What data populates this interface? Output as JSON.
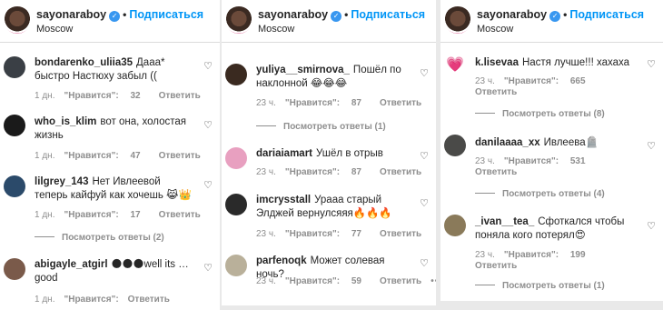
{
  "header": {
    "username": "sayonaraboy",
    "verified_mark": "✓",
    "separator": "•",
    "follow_label": "Подписаться",
    "location": "Moscow"
  },
  "common": {
    "likes_prefix": "\"Нравится\":",
    "reply_label": "Ответить",
    "heart": "♡"
  },
  "panels": [
    {
      "comments": [
        {
          "user": "bondarenko_uliia35",
          "text": "Дааа* быстро Настюху забыл ((",
          "time": "1 дн.",
          "likes": "32",
          "avatar_color": "#3a3f45"
        },
        {
          "user": "who_is_klim",
          "text": "вот она, холостая жизнь",
          "time": "1 дн.",
          "likes": "47",
          "avatar_color": "#1a1a1a"
        },
        {
          "user": "lilgrey_143",
          "text": "Нет Ивлеевой теперь кайфуй как хочешь 😹👑",
          "time": "1 дн.",
          "likes": "17",
          "avatar_color": "#2b4a6a",
          "replies": "Посмотреть ответы (2)"
        },
        {
          "user": "abigayle_atgirl",
          "text": "🌑🌑🌑well its … good",
          "time": "1 дн.",
          "likes": "",
          "avatar_color": "#7a5a4a"
        }
      ]
    },
    {
      "comments": [
        {
          "user": "yuliya__smirnova_",
          "text": "Пошёл по наклонной 😂😂😂",
          "time": "23 ч.",
          "likes": "87",
          "avatar_color": "#3a2a20",
          "replies": "Посмотреть ответы (1)"
        },
        {
          "user": "dariaiamart",
          "text": "Ушёл в отрыв",
          "time": "23 ч.",
          "likes": "87",
          "avatar_color": "#e8a0c0"
        },
        {
          "user": "imcrysstall",
          "text": "Урааа старый Элджей вернулсяяя🔥🔥🔥",
          "time": "23 ч.",
          "likes": "77",
          "avatar_color": "#2a2a2a"
        },
        {
          "user": "parfenoqk",
          "text": "Может солевая ночь?",
          "time": "23 ч.",
          "likes": "59",
          "avatar_color": "#b9b09a",
          "more": "•••"
        }
      ]
    },
    {
      "comments": [
        {
          "user": "k.lisevaa",
          "text": "Настя лучше!!! хахаха",
          "time": "23 ч.",
          "likes": "665",
          "avatar_color": "#ffffff",
          "avatar_icon": "💗",
          "replies": "Посмотреть ответы (8)"
        },
        {
          "user": "danilaaaa_xx",
          "text": "Ивлеева🪦",
          "time": "23 ч.",
          "likes": "531",
          "avatar_color": "#4a4a48",
          "replies": "Посмотреть ответы (4)"
        },
        {
          "user": "_ivan__tea_",
          "text": "Сфоткался чтобы поняла кого потерял😍",
          "time": "23 ч.",
          "likes": "199",
          "avatar_color": "#8a7a5a",
          "replies": "Посмотреть ответы (1)"
        }
      ]
    }
  ]
}
